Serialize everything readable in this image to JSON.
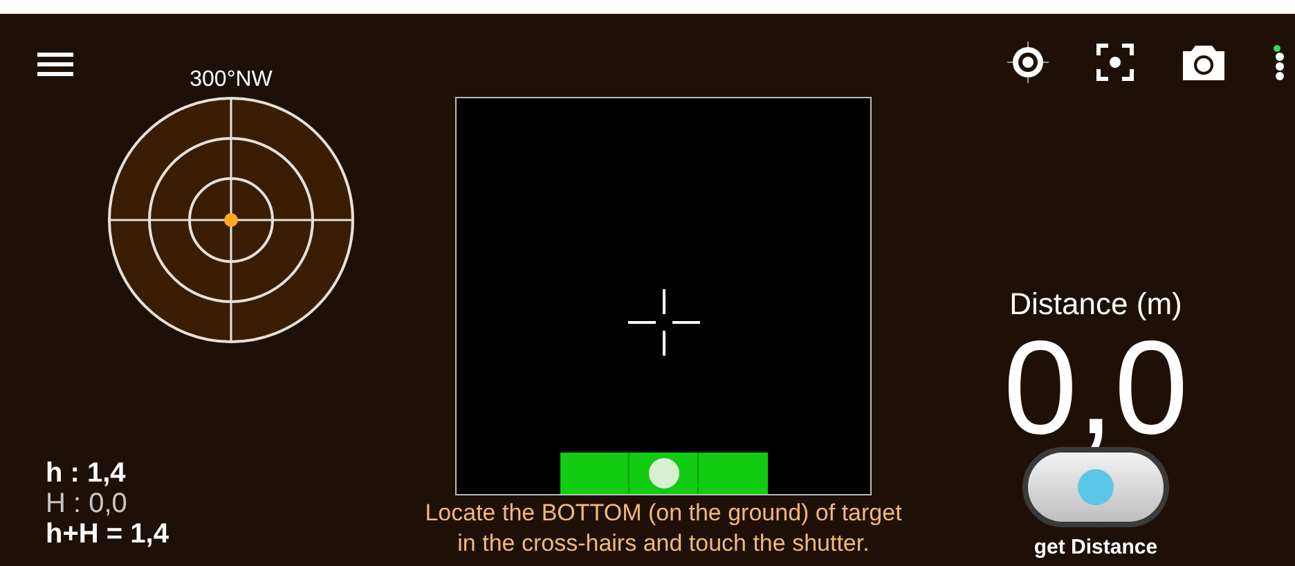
{
  "compass": {
    "heading": "300°NW"
  },
  "heights": [
    {
      "text": "h : 1,4",
      "dim": false
    },
    {
      "text": "H : 0,0",
      "dim": true
    },
    {
      "text": "h+H = 1,4",
      "dim": false
    }
  ],
  "level_bubble": {
    "level": 0.5
  },
  "instruction": [
    "Locate the BOTTOM (on the ground) of target",
    "in the cross-hairs and touch the shutter."
  ],
  "distance": {
    "label": "Distance (m)",
    "value": "0,0"
  },
  "shutter": {
    "label": "get Distance"
  }
}
